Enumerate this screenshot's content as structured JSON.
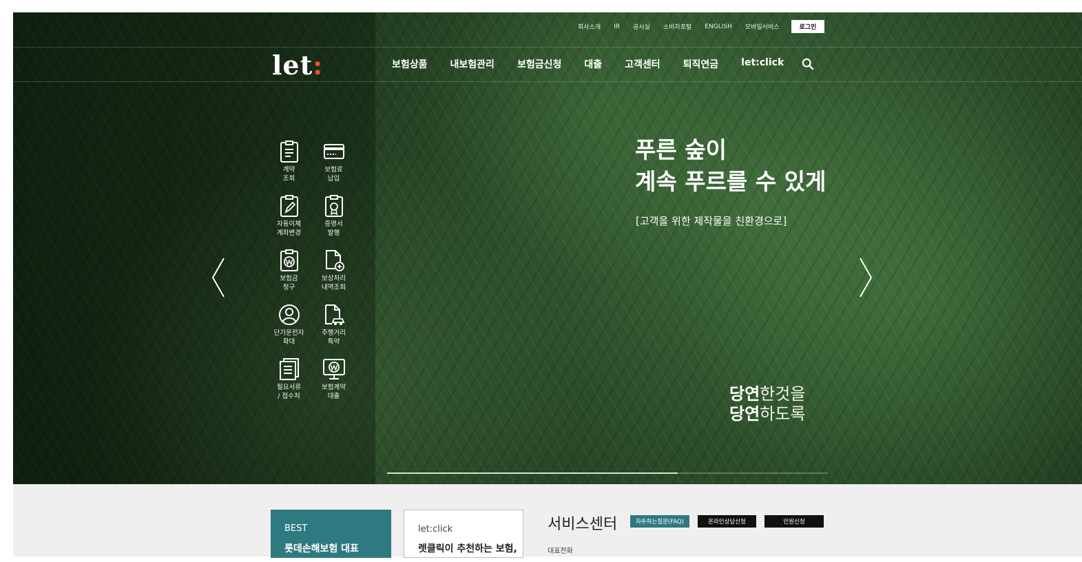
{
  "utility_nav": {
    "items": [
      "회사소개",
      "IR",
      "공시실",
      "소비자포털",
      "ENGLISH",
      "모바일서비스"
    ],
    "login": "로그인"
  },
  "logo": {
    "text": "let",
    "colon": ":"
  },
  "gnb": {
    "items": [
      "보험상품",
      "내보험관리",
      "보험금신청",
      "대출",
      "고객센터",
      "퇴직연금",
      "let:click"
    ],
    "search_icon": "search-icon"
  },
  "quick_menu": [
    {
      "label": "계약\n조회",
      "icon": "clipboard-doc-icon"
    },
    {
      "label": "보험료\n납입",
      "icon": "card-icon"
    },
    {
      "label": "자동이체\n계좌변경",
      "icon": "clipboard-edit-icon"
    },
    {
      "label": "증명서\n발행",
      "icon": "clipboard-badge-icon"
    },
    {
      "label": "보험금\n청구",
      "icon": "clipboard-won-icon"
    },
    {
      "label": "보상처리\n내역조회",
      "icon": "doc-add-icon"
    },
    {
      "label": "단기운전자\n확대",
      "icon": "user-circle-icon"
    },
    {
      "label": "주행거리\n특약",
      "icon": "doc-car-icon"
    },
    {
      "label": "필요서류\n/ 접수처",
      "icon": "documents-icon"
    },
    {
      "label": "보험계약\n대출",
      "icon": "monitor-won-icon"
    }
  ],
  "hero": {
    "headline": "푸른 숲이\n계속 푸르를 수 있게",
    "subline": "[고객을 위한 제작물을 친환경으로]",
    "tag_bold_1": "당연",
    "tag_rest_1": "한것을",
    "tag_bold_2": "당연",
    "tag_rest_2": "하도록",
    "progress": 0.66
  },
  "bottom": {
    "card_best": {
      "badge": "BEST",
      "title": "롯데손해보험 대표"
    },
    "card_click": {
      "badge": "let:click",
      "title": "렛클릭이 추천하는 보험,"
    },
    "service_center": {
      "title": "서비스센터",
      "buttons": [
        "자주하는질문(FAQ)",
        "온라인상담신청",
        "민원신청"
      ],
      "phone_label": "대표전화"
    }
  },
  "colors": {
    "accent": "#e8542c",
    "teal": "#2e7a80",
    "button_dark": "#111111"
  }
}
